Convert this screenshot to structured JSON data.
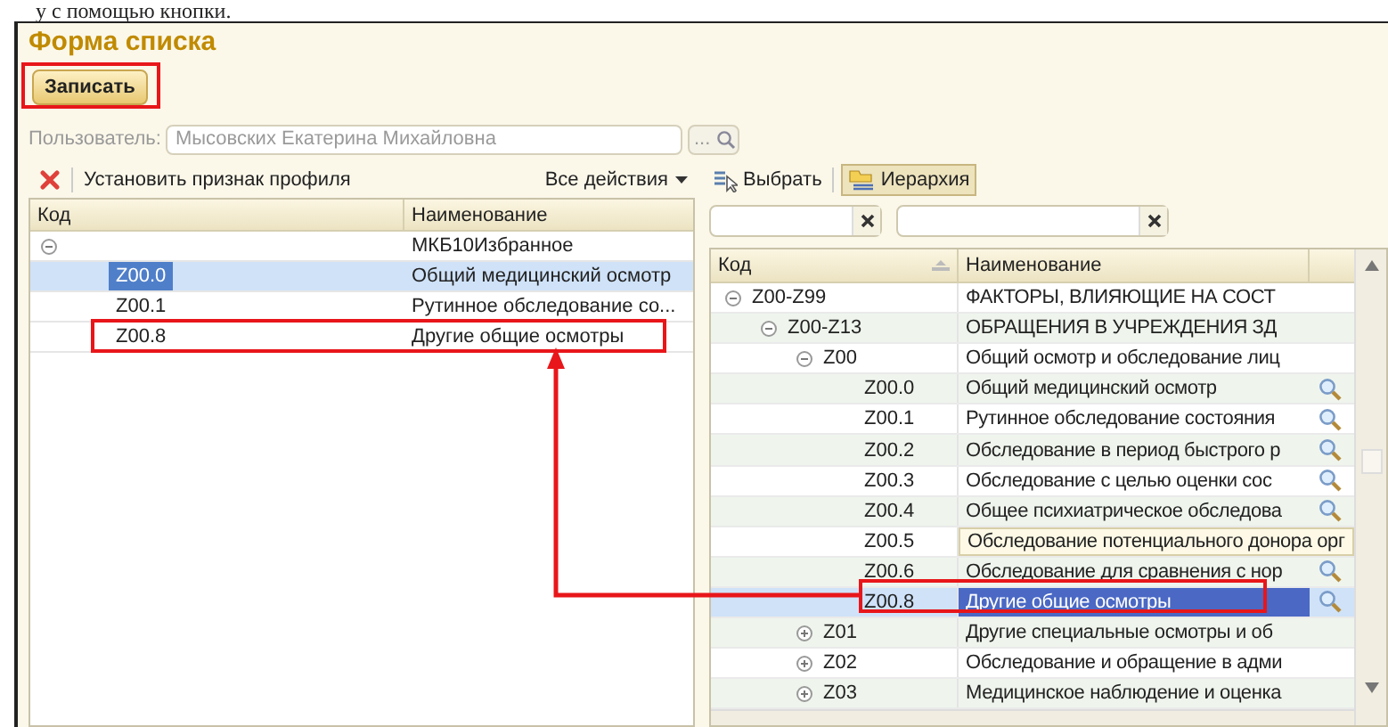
{
  "document_line": "у с помощью кнопки.",
  "window": {
    "title": "Форма списка"
  },
  "save_button": {
    "label": "Записать"
  },
  "user_field": {
    "label": "Пользователь:",
    "value": "Мысовских Екатерина Михайловна",
    "button": "..."
  },
  "left_toolbar": {
    "action": "Установить признак профиля",
    "menu": "Все действия"
  },
  "left_table": {
    "columns": [
      "Код",
      "Наименование"
    ],
    "rows": [
      {
        "name": "МКБ10Избранное",
        "expanded": true,
        "selected": false,
        "children": [
          {
            "code": "Z00.0",
            "name": "Общий медицинский осмотр",
            "selected": true
          },
          {
            "code": "Z00.1",
            "name": "Рутинное обследование со...",
            "selected": false
          },
          {
            "code": "Z00.8",
            "name": "Другие общие осмотры",
            "selected": false
          }
        ]
      }
    ]
  },
  "right_toolbar": {
    "select_button": "Выбрать",
    "hierarchy_button": {
      "label": "Иерархия",
      "pressed": true
    }
  },
  "right_table": {
    "columns": [
      "Код",
      "Наименование"
    ],
    "rows": [
      {
        "code": "Z00-Z99",
        "name": "ФАКТОРЫ, ВЛИЯЮЩИЕ НА СОСТ",
        "expanded": true,
        "selected": false,
        "children": [
          {
            "code": "Z00-Z13",
            "name": "ОБРАЩЕНИЯ В УЧРЕЖДЕНИЯ ЗД",
            "expanded": true,
            "selected": false,
            "children": [
              {
                "code": "Z00",
                "name": "Общий осмотр и обследование лиц",
                "expanded": true,
                "selected": false,
                "children": [
                  {
                    "code": "Z00.0",
                    "name": "Общий медицинский осмотр",
                    "selected": false
                  },
                  {
                    "code": "Z00.1",
                    "name": "Рутинное обследование состояния",
                    "selected": false
                  },
                  {
                    "code": "Z00.2",
                    "name": "Обследование в период быстрого р",
                    "selected": false
                  },
                  {
                    "code": "Z00.3",
                    "name": "Обследование с целью оценки сос",
                    "selected": false
                  },
                  {
                    "code": "Z00.4",
                    "name": "Общее психиатрическое обследова",
                    "selected": false
                  },
                  {
                    "code": "Z00.5",
                    "name": "Обследование потенциального донора орг",
                    "selected": false,
                    "overflow": true
                  },
                  {
                    "code": "Z00.6",
                    "name": "Обследование для сравнения с нор",
                    "selected": false
                  },
                  {
                    "code": "Z00.8",
                    "name": "Другие общие осмотры",
                    "selected": true
                  }
                ]
              },
              {
                "code": "Z01",
                "name": "Другие специальные осмотры и об",
                "expanded": false,
                "selected": false
              },
              {
                "code": "Z02",
                "name": "Обследование и обращение в адми",
                "expanded": false,
                "selected": false
              },
              {
                "code": "Z03",
                "name": "Медицинское наблюдение и оценка",
                "expanded": false,
                "selected": false
              }
            ]
          }
        ]
      }
    ]
  }
}
